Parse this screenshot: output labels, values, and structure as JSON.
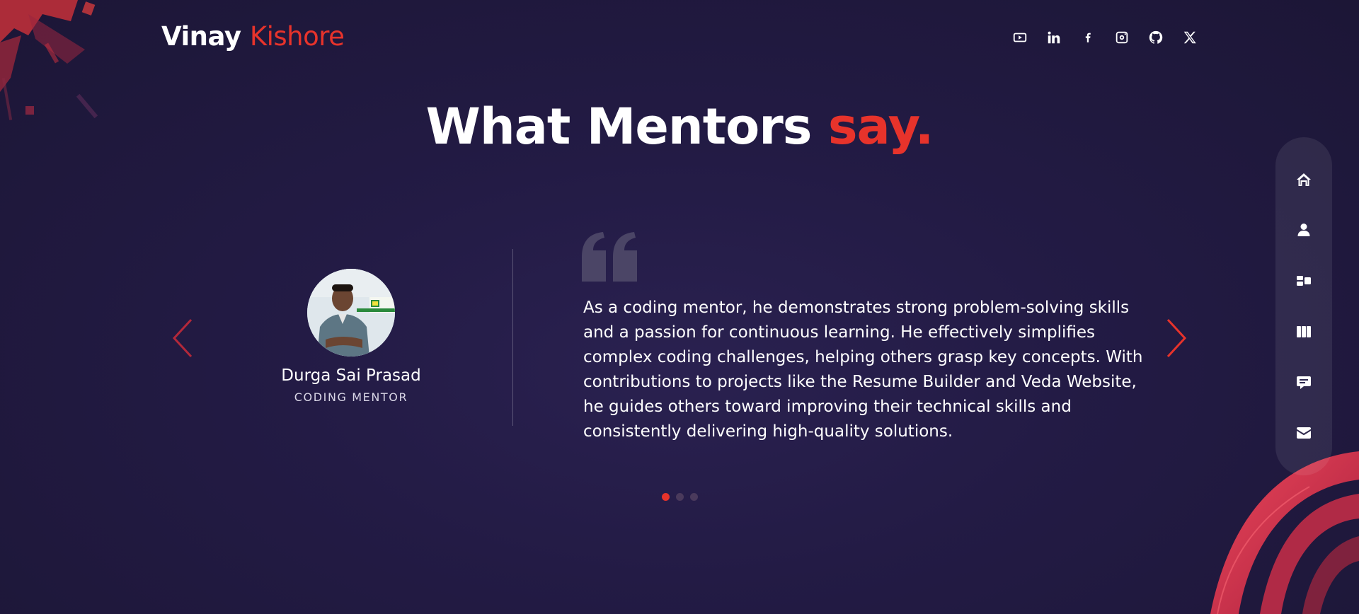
{
  "brand": {
    "first": "Vinay",
    "last": "Kishore",
    "accent_color": "#e7332b"
  },
  "social_links": [
    {
      "name": "youtube-icon"
    },
    {
      "name": "linkedin-icon"
    },
    {
      "name": "facebook-icon"
    },
    {
      "name": "instagram-icon"
    },
    {
      "name": "github-icon"
    },
    {
      "name": "x-icon"
    }
  ],
  "section": {
    "title_main": "What Mentors",
    "title_accent": "say."
  },
  "testimonial": {
    "name": "Durga Sai Prasad",
    "role": "CODING MENTOR",
    "quote": "As a coding mentor, he demonstrates strong problem-solving skills and a passion for continuous learning. He effectively simplifies complex coding challenges, helping others grasp key concepts. With contributions to projects like the Resume Builder and Veda Website, he guides others toward improving their technical skills and consistently delivering high-quality solutions."
  },
  "carousel": {
    "total_slides": 3,
    "active_slide": 1
  },
  "side_nav": [
    {
      "name": "home-icon"
    },
    {
      "name": "user-icon"
    },
    {
      "name": "services-icon"
    },
    {
      "name": "portfolio-icon"
    },
    {
      "name": "testimonials-icon"
    },
    {
      "name": "mail-icon"
    }
  ],
  "colors": {
    "background": "#231b45",
    "accent": "#e7332b",
    "text": "#ffffff"
  }
}
